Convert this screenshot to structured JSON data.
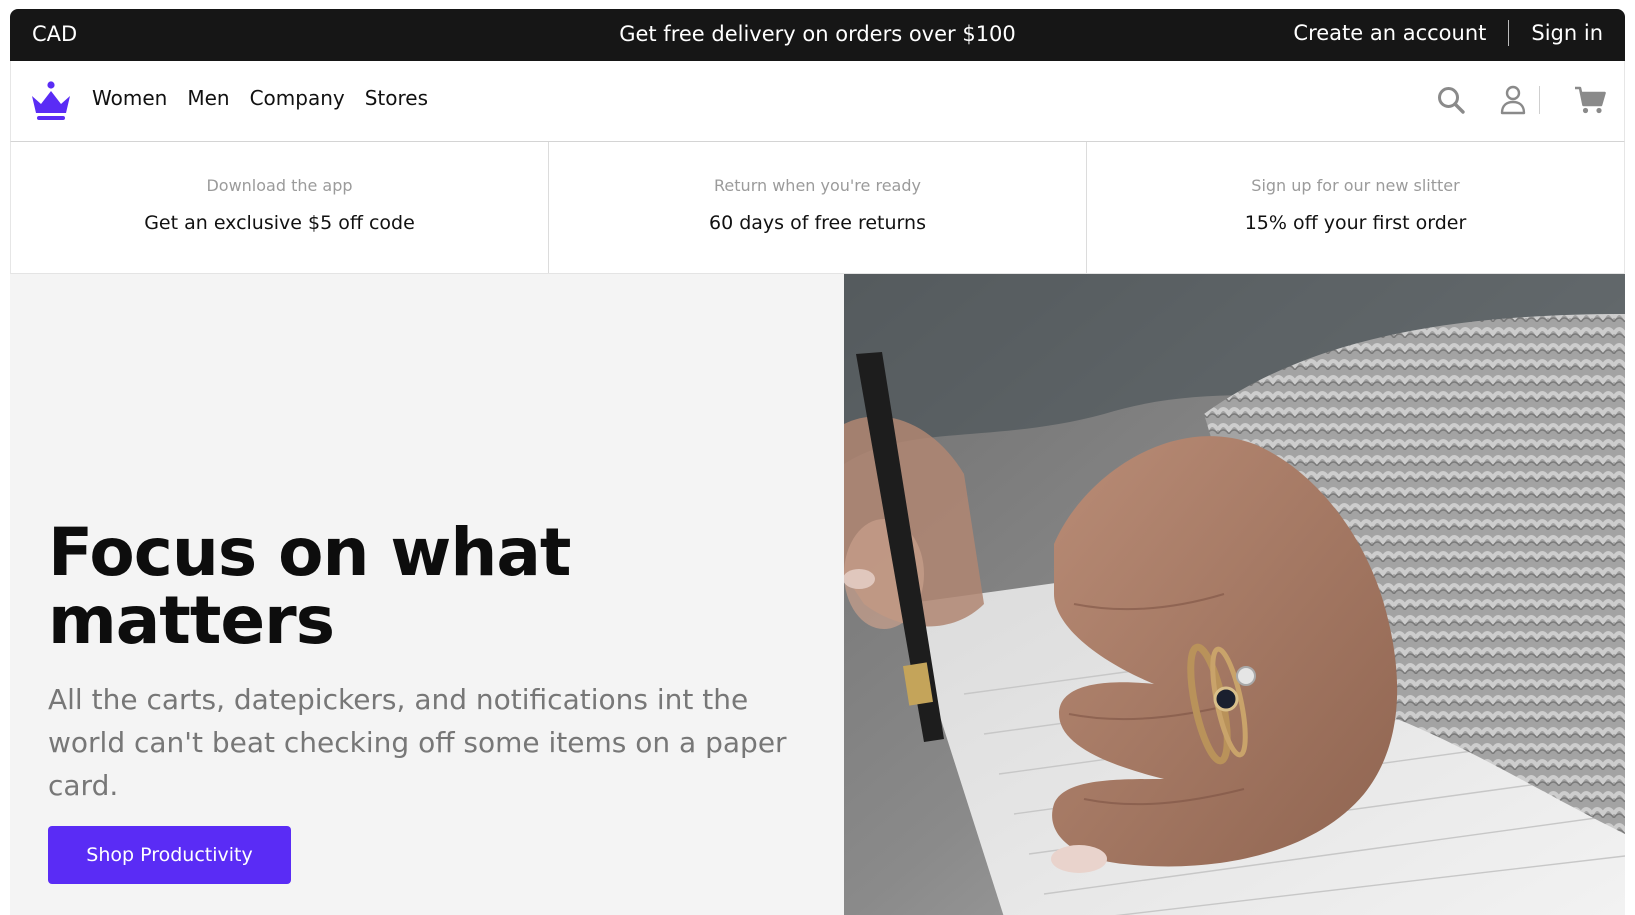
{
  "topbar": {
    "currency": "CAD",
    "promo": "Get free delivery on orders over $100",
    "create_account": "Create an account",
    "sign_in": "Sign in"
  },
  "nav": {
    "links": [
      "Women",
      "Men",
      "Company",
      "Stores"
    ],
    "icons": [
      "crown-logo-icon",
      "search-icon",
      "user-icon",
      "cart-icon"
    ]
  },
  "perks": [
    {
      "sub": "Download the app",
      "main": "Get an exclusive $5 off code"
    },
    {
      "sub": "Return when you're ready",
      "main": "60 days of free returns"
    },
    {
      "sub": "Sign up for our new slitter",
      "main": "15% off your first order"
    }
  ],
  "hero": {
    "headline": "Focus on what matters",
    "description": "All the carts, datepickers, and notifications int the world can't beat checking off some items on a paper card.",
    "cta": "Shop Productivity"
  },
  "colors": {
    "accent": "#5a2cf5",
    "topbar_bg": "#161616",
    "hero_bg": "#f4f4f4"
  }
}
